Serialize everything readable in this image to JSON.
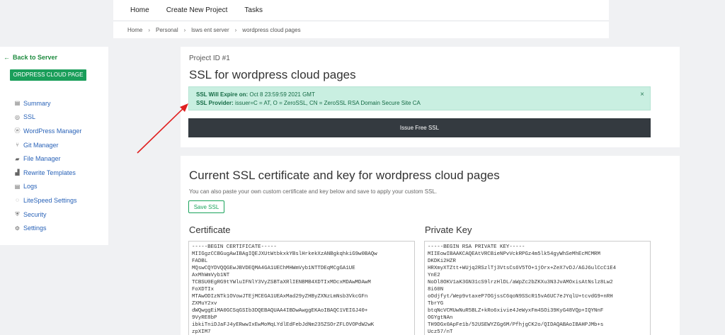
{
  "topnav": {
    "home": "Home",
    "create": "Create New Project",
    "tasks": "Tasks"
  },
  "breadcrumb": [
    "Home",
    "Personal",
    "lsws ent server",
    "wordpress cloud pages"
  ],
  "sidebar": {
    "back": "Back to Server",
    "site": "ORDPRESS CLOUD PAGE",
    "items": [
      {
        "label": "Summary",
        "icon": "summary-icon",
        "glyph": "▤"
      },
      {
        "label": "SSL",
        "icon": "ssl-icon",
        "glyph": "◎"
      },
      {
        "label": "WordPress Manager",
        "icon": "wordpress-icon",
        "glyph": "ⓦ"
      },
      {
        "label": "Git Manager",
        "icon": "git-icon",
        "glyph": "⑂"
      },
      {
        "label": "File Manager",
        "icon": "folder-icon",
        "glyph": "▰"
      },
      {
        "label": "Rewrite Templates",
        "icon": "rewrite-icon",
        "glyph": "▟"
      },
      {
        "label": "Logs",
        "icon": "logs-icon",
        "glyph": "▤"
      },
      {
        "label": "LiteSpeed Settings",
        "icon": "litespeed-icon",
        "glyph": "◌"
      },
      {
        "label": "Security",
        "icon": "shield-icon",
        "glyph": "⛨"
      },
      {
        "label": "Settings",
        "icon": "gear-icon",
        "glyph": "⚙"
      }
    ]
  },
  "ssl_card": {
    "project_id": "Project ID #1",
    "title": "SSL for wordpress cloud pages",
    "expire_label": "SSL Will Expire on:",
    "expire_value": " Oct 8 23:59:59 2021 GMT",
    "provider_label": "SSL Provider:",
    "provider_value": " issuer=C = AT, O = ZeroSSL, CN = ZeroSSL RSA Domain Secure Site CA",
    "close": "×",
    "issue_button": "Issue Free SSL"
  },
  "cert_card": {
    "title": "Current SSL certificate and key for wordpress cloud pages",
    "description": "You can also paste your own custom certificate and key below and save to apply your custom SSL.",
    "save_button": "Save SSL",
    "certificate_label": "Certificate",
    "private_key_label": "Private Key",
    "certificate_text": "-----BEGIN CERTIFICATE-----\nMIIGgzCCBGugAwIBAgIQEJXUtWtbkxkYBslHrkekXzANBgkqhkiG9w0BAQw\nFADBL\nMQswCQYDVQQGEwJBVDEQMA4GA1UEChMHWmVyb1NTTDEqMCgGA1UE\nAxMhWmVyb1NT\nTCBSU0EgRG9tYWluIFNlY3VyZSBTaXRlIENBMB4XDTIxMDcxMDAwMDAwM\nFoXDTIx\nMTAwODIzNTk1OVowJTEjMCEGA1UEAxMad29yZHByZXNzLmNsb3VkcGFn\nZXMuY2xv\ndWQwggEiMA0GCSqGSIb3DQEBAQUAA4IBDwAwggEKAoIBAQC1VEIGJ40+\n9VyRE8bP\nibkiTniDJaFJ4yERwwIxEwMoMqLYdlEdFebJdNm235ZSOrZFLOVOPdW2wK\nzpXIM7",
    "private_key_text": "-----BEGIN RSA PRIVATE KEY-----\nMIIEowIBAAKCAQEAtVRCBieNPvVckRPGz4m5lk54gyWhSeMhEcMCMRM\nDKDKi2HZR\nHRXmyXTZtt+WUjq2RSzlTj3VtsCs6V5TO+1jOrx+ZeX7vDJ/AGJ6ulCcC1E4\nYnE2\nNoDl8OKV1aK3GN31cS9lrzHlDL/aWpZc2bZKXu3N3JvAMOxisAtNslz8Lw2\n8i60N\noOdjfyt/Wep9vtaxeP7OGjssC6qoN9SScR15vA6UC7eJYqlU+tcvdG9+nRH\nTbrYG\nbtqNcVCMUwNuR5BLZ+kRo6xivie4JeWyxFm4SOi39KyG48VQp+IQYNnF\nOGYgtNAn\nTH9DGx0ApFe1b/52USEWYZGg6M/PfhjgCK2o/QIDAQABAoIBAHPJMb+s\nUcz57/nT"
  }
}
